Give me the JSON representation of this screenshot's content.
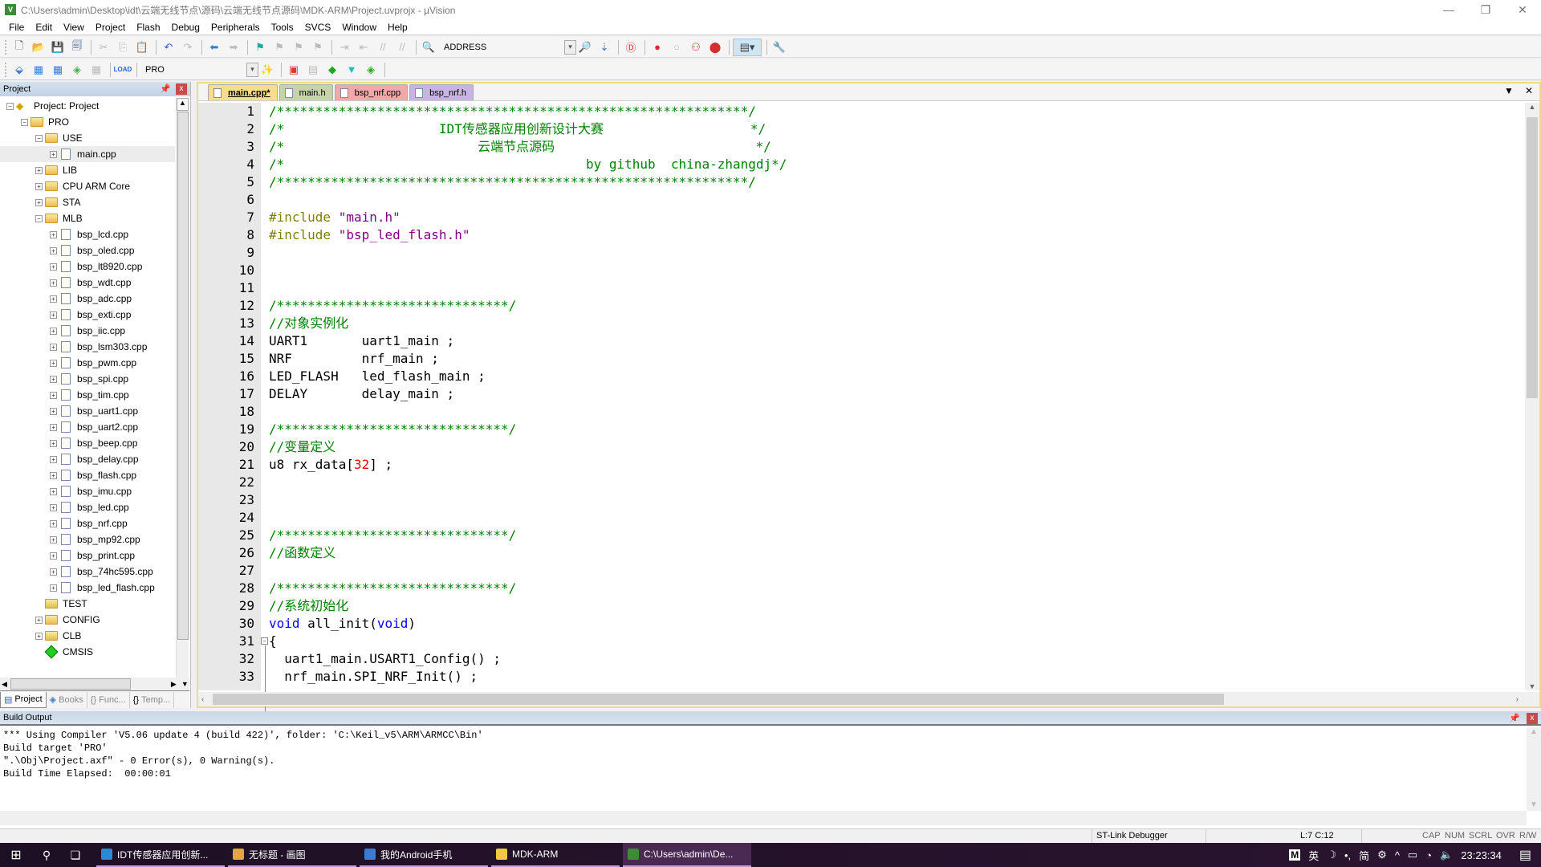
{
  "window": {
    "title": "C:\\Users\\admin\\Desktop\\idt\\云端无线节点\\源码\\云端无线节点源码\\MDK-ARM\\Project.uvprojx - µVision",
    "app_icon": "uvision-icon",
    "controls": {
      "minimize": "—",
      "restore": "❐",
      "close": "✕"
    }
  },
  "menu": [
    "File",
    "Edit",
    "View",
    "Project",
    "Flash",
    "Debug",
    "Peripherals",
    "Tools",
    "SVCS",
    "Window",
    "Help"
  ],
  "toolbar1": {
    "address_label": "ADDRESS",
    "icons": [
      "new-file-icon",
      "open-file-icon",
      "save-icon",
      "save-all-icon",
      "cut-icon",
      "copy-icon",
      "paste-icon",
      "undo-icon",
      "redo-icon",
      "nav-back-icon",
      "nav-forward-icon",
      "bookmark-icon",
      "prev-bookmark-icon",
      "next-bookmark-icon",
      "clear-bookmarks-icon",
      "indent-icon",
      "unindent-icon",
      "comment-icon",
      "uncomment-icon",
      "find-in-files-icon",
      "find-icon",
      "incremental-find-icon",
      "debug-session-icon",
      "breakpoint-icon",
      "disable-breakpoint-icon",
      "disable-all-breakpoints-icon",
      "kill-all-breakpoints-icon",
      "window-layout-icon",
      "configure-icon"
    ]
  },
  "toolbar2": {
    "target": "PRO",
    "icons": [
      "translate-icon",
      "build-icon",
      "rebuild-icon",
      "batch-build-icon",
      "stop-build-icon",
      "download-icon",
      "target-options-icon",
      "file-extensions-icon",
      "manage-runtime-icon",
      "select-pack-icon",
      "pack-installer-icon"
    ],
    "load_label": "LOAD"
  },
  "project_panel": {
    "title": "Project",
    "tree": [
      {
        "label": "Project: Project",
        "level": 0,
        "type": "project",
        "expanded": true
      },
      {
        "label": "PRO",
        "level": 1,
        "type": "target",
        "expanded": true
      },
      {
        "label": "USE",
        "level": 2,
        "type": "folder-open",
        "expanded": true
      },
      {
        "label": "main.cpp",
        "level": 3,
        "type": "file",
        "selected": true
      },
      {
        "label": "LIB",
        "level": 2,
        "type": "folder",
        "expanded": false
      },
      {
        "label": "CPU ARM Core",
        "level": 2,
        "type": "folder",
        "expanded": false
      },
      {
        "label": "STA",
        "level": 2,
        "type": "folder",
        "expanded": false
      },
      {
        "label": "MLB",
        "level": 2,
        "type": "folder-open",
        "expanded": true
      },
      {
        "label": "bsp_lcd.cpp",
        "level": 3,
        "type": "file"
      },
      {
        "label": "bsp_oled.cpp",
        "level": 3,
        "type": "file"
      },
      {
        "label": "bsp_lt8920.cpp",
        "level": 3,
        "type": "file"
      },
      {
        "label": "bsp_wdt.cpp",
        "level": 3,
        "type": "file"
      },
      {
        "label": "bsp_adc.cpp",
        "level": 3,
        "type": "file"
      },
      {
        "label": "bsp_exti.cpp",
        "level": 3,
        "type": "file"
      },
      {
        "label": "bsp_iic.cpp",
        "level": 3,
        "type": "file"
      },
      {
        "label": "bsp_lsm303.cpp",
        "level": 3,
        "type": "file"
      },
      {
        "label": "bsp_pwm.cpp",
        "level": 3,
        "type": "file"
      },
      {
        "label": "bsp_spi.cpp",
        "level": 3,
        "type": "file"
      },
      {
        "label": "bsp_tim.cpp",
        "level": 3,
        "type": "file"
      },
      {
        "label": "bsp_uart1.cpp",
        "level": 3,
        "type": "file"
      },
      {
        "label": "bsp_uart2.cpp",
        "level": 3,
        "type": "file"
      },
      {
        "label": "bsp_beep.cpp",
        "level": 3,
        "type": "file"
      },
      {
        "label": "bsp_delay.cpp",
        "level": 3,
        "type": "file"
      },
      {
        "label": "bsp_flash.cpp",
        "level": 3,
        "type": "file"
      },
      {
        "label": "bsp_imu.cpp",
        "level": 3,
        "type": "file"
      },
      {
        "label": "bsp_led.cpp",
        "level": 3,
        "type": "file"
      },
      {
        "label": "bsp_nrf.cpp",
        "level": 3,
        "type": "file"
      },
      {
        "label": "bsp_mp92.cpp",
        "level": 3,
        "type": "file"
      },
      {
        "label": "bsp_print.cpp",
        "level": 3,
        "type": "file"
      },
      {
        "label": "bsp_74hc595.cpp",
        "level": 3,
        "type": "file"
      },
      {
        "label": "bsp_led_flash.cpp",
        "level": 3,
        "type": "file"
      },
      {
        "label": "TEST",
        "level": 2,
        "type": "folder-open-empty"
      },
      {
        "label": "CONFIG",
        "level": 2,
        "type": "folder",
        "expanded": false
      },
      {
        "label": "CLB",
        "level": 2,
        "type": "folder",
        "expanded": false
      },
      {
        "label": "CMSIS",
        "level": 2,
        "type": "component"
      }
    ],
    "bottom_tabs": [
      {
        "label": "Project",
        "active": true
      },
      {
        "label": "Books",
        "active": false
      },
      {
        "label": "{} Func...",
        "active": false
      },
      {
        "label": "Temp...",
        "active": false
      }
    ]
  },
  "editor": {
    "tabs": [
      {
        "label": "main.cpp*",
        "active": true,
        "color": "#f9dc8c"
      },
      {
        "label": "main.h",
        "active": false,
        "color": "#c5d4a8"
      },
      {
        "label": "bsp_nrf.cpp",
        "active": false,
        "color": "#f0a8a8"
      },
      {
        "label": "bsp_nrf.h",
        "active": false,
        "color": "#c8b4e2"
      }
    ],
    "lines": [
      [
        [
          "c-comment",
          "/*************************************************************/"
        ]
      ],
      [
        [
          "c-comment",
          "/*                    IDT传感器应用创新设计大赛                   */"
        ]
      ],
      [
        [
          "c-comment",
          "/*                         云端节点源码                          */"
        ]
      ],
      [
        [
          "c-comment",
          "/*                                       by github  china-zhangdj*/"
        ]
      ],
      [
        [
          "c-comment",
          "/*************************************************************/"
        ]
      ],
      [],
      [
        [
          "c-pre",
          "#include "
        ],
        [
          "c-str",
          "\"main.h\""
        ]
      ],
      [
        [
          "c-pre",
          "#include "
        ],
        [
          "c-str",
          "\"bsp_led_flash.h\""
        ]
      ],
      [],
      [],
      [],
      [
        [
          "c-comment",
          "/******************************/"
        ]
      ],
      [
        [
          "c-comment",
          "//对象实例化"
        ]
      ],
      [
        [
          "",
          "UART1       uart1_main ;"
        ]
      ],
      [
        [
          "",
          "NRF         nrf_main ;"
        ]
      ],
      [
        [
          "",
          "LED_FLASH   led_flash_main ;"
        ]
      ],
      [
        [
          "",
          "DELAY       delay_main ;"
        ]
      ],
      [],
      [
        [
          "c-comment",
          "/******************************/"
        ]
      ],
      [
        [
          "c-comment",
          "//变量定义"
        ]
      ],
      [
        [
          "",
          "u8 rx_data["
        ],
        [
          "c-num",
          "32"
        ],
        [
          "",
          "] ;"
        ]
      ],
      [],
      [],
      [],
      [
        [
          "c-comment",
          "/******************************/"
        ]
      ],
      [
        [
          "c-comment",
          "//函数定义"
        ]
      ],
      [],
      [
        [
          "c-comment",
          "/******************************/"
        ]
      ],
      [
        [
          "c-comment",
          "//系统初始化"
        ]
      ],
      [
        [
          "c-kw",
          "void"
        ],
        [
          "",
          " all_init("
        ],
        [
          "c-kw",
          "void"
        ],
        [
          "",
          ")"
        ]
      ],
      [
        [
          "",
          "{"
        ]
      ],
      [
        [
          "",
          "  uart1_main.USART1_Config() ;"
        ]
      ],
      [
        [
          "",
          "  nrf_main.SPI_NRF_Init() ;"
        ]
      ]
    ],
    "fold_line": 31
  },
  "build_output": {
    "title": "Build Output",
    "lines": [
      "*** Using Compiler 'V5.06 update 4 (build 422)', folder: 'C:\\Keil_v5\\ARM\\ARMCC\\Bin'",
      "Build target 'PRO'",
      "\".\\Obj\\Project.axf\" - 0 Error(s), 0 Warning(s).",
      "Build Time Elapsed:  00:00:01"
    ]
  },
  "status_bar": {
    "debugger": "ST-Link Debugger",
    "cursor": "L:7 C:12",
    "indicators": [
      "CAP",
      "NUM",
      "SCRL",
      "OVR",
      "R/W"
    ]
  },
  "taskbar": {
    "apps": [
      {
        "label": "IDT传感器应用创新...",
        "icon_color": "#2b88d8",
        "active": false
      },
      {
        "label": "无标题 - 画图",
        "icon_color": "#e8a33d",
        "active": false
      },
      {
        "label": "我的Android手机",
        "icon_color": "#3a7bd5",
        "active": false
      },
      {
        "label": "MDK-ARM",
        "icon_color": "#f2c744",
        "active": false
      },
      {
        "label": "C:\\Users\\admin\\De...",
        "icon_color": "#3d8b37",
        "active": true
      }
    ],
    "tray": {
      "ime": [
        "M",
        "英",
        "☽",
        "•,",
        "简",
        "⚙"
      ],
      "time": "23:23:34"
    }
  }
}
